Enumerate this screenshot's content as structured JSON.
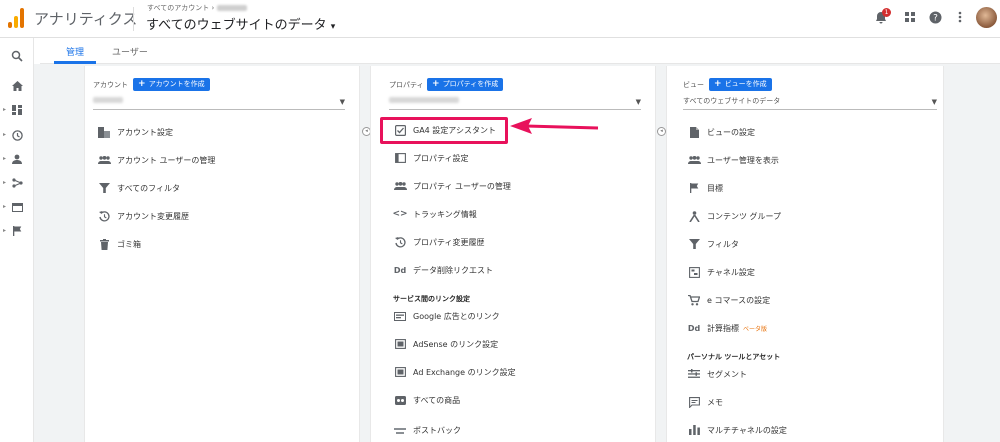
{
  "app": {
    "name": "アナリティクス"
  },
  "header": {
    "breadcrumb": "すべてのアカウント",
    "breadcrumb_sep": "›",
    "property_title": "すべてのウェブサイトのデータ",
    "notification_count": "1"
  },
  "tabs": {
    "admin": "管理",
    "user": "ユーザー"
  },
  "account": {
    "label": "アカウント",
    "create": "アカウントを作成",
    "items": [
      "アカウント設定",
      "アカウント ユーザーの管理",
      "すべてのフィルタ",
      "アカウント変更履歴",
      "ゴミ箱"
    ]
  },
  "property": {
    "label": "プロパティ",
    "create": "プロパティを作成",
    "items": [
      "GA4 設定アシスタント",
      "プロパティ設定",
      "プロパティ ユーザーの管理",
      "トラッキング情報",
      "プロパティ変更履歴",
      "データ削除リクエスト"
    ],
    "link_section": "サービス間のリンク設定",
    "links": [
      "Google 広告とのリンク",
      "AdSense のリンク設定",
      "Ad Exchange のリンク設定",
      "すべての商品",
      "ポストバック"
    ]
  },
  "view": {
    "label": "ビュー",
    "create": "ビューを作成",
    "selected": "すべてのウェブサイトのデータ",
    "items": [
      "ビューの設定",
      "ユーザー管理を表示",
      "目標",
      "コンテンツ グループ",
      "フィルタ",
      "チャネル設定",
      "e コマースの設定",
      "計算指標"
    ],
    "beta": "ベータ版",
    "personal_section": "パーソナル ツールとアセット",
    "personal": [
      "セグメント",
      "メモ",
      "マルチチャネルの設定"
    ]
  },
  "colors": {
    "accent": "#1a73e8",
    "highlight": "#e8115b"
  }
}
